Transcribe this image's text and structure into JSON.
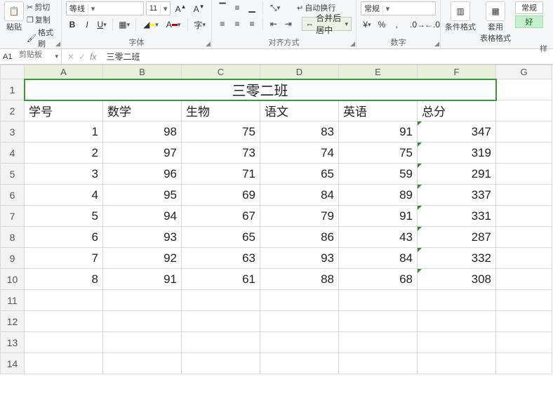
{
  "ribbon": {
    "clipboard": {
      "paste": "粘贴",
      "cut": "剪切",
      "copy": "复制",
      "format_painter": "格式刷",
      "label": "剪贴板"
    },
    "font": {
      "font_name": "等线",
      "font_size": "11",
      "bold": "B",
      "italic": "I",
      "underline": "U",
      "label": "字体"
    },
    "alignment": {
      "wrap": "自动换行",
      "merge": "合并后居中",
      "label": "对齐方式"
    },
    "number": {
      "format": "常规",
      "label": "数字"
    },
    "styles": {
      "cond_format": "条件格式",
      "table_format": "套用\n表格格式",
      "normal": "常规",
      "good": "好",
      "label": "样"
    }
  },
  "formula_bar": {
    "name_box": "A1",
    "fx": "fx",
    "value": "三零二班"
  },
  "columns": [
    "A",
    "B",
    "C",
    "D",
    "E",
    "F",
    "G"
  ],
  "row_count": 14,
  "title_row": {
    "text": "三零二班"
  },
  "header_row": [
    "学号",
    "数学",
    "生物",
    "语文",
    "英语",
    "总分"
  ],
  "data_rows": [
    [
      "1",
      "98",
      "75",
      "83",
      "91",
      "347"
    ],
    [
      "2",
      "97",
      "73",
      "74",
      "75",
      "319"
    ],
    [
      "3",
      "96",
      "71",
      "65",
      "59",
      "291"
    ],
    [
      "4",
      "95",
      "69",
      "84",
      "89",
      "337"
    ],
    [
      "5",
      "94",
      "67",
      "79",
      "91",
      "331"
    ],
    [
      "6",
      "93",
      "65",
      "86",
      "43",
      "287"
    ],
    [
      "7",
      "92",
      "63",
      "93",
      "84",
      "332"
    ],
    [
      "8",
      "91",
      "61",
      "88",
      "68",
      "308"
    ]
  ],
  "chart_data": {
    "type": "table",
    "title": "三零二班",
    "columns": [
      "学号",
      "数学",
      "生物",
      "语文",
      "英语",
      "总分"
    ],
    "rows": [
      {
        "学号": 1,
        "数学": 98,
        "生物": 75,
        "语文": 83,
        "英语": 91,
        "总分": 347
      },
      {
        "学号": 2,
        "数学": 97,
        "生物": 73,
        "语文": 74,
        "英语": 75,
        "总分": 319
      },
      {
        "学号": 3,
        "数学": 96,
        "生物": 71,
        "语文": 65,
        "英语": 59,
        "总分": 291
      },
      {
        "学号": 4,
        "数学": 95,
        "生物": 69,
        "语文": 84,
        "英语": 89,
        "总分": 337
      },
      {
        "学号": 5,
        "数学": 94,
        "生物": 67,
        "语文": 79,
        "英语": 91,
        "总分": 331
      },
      {
        "学号": 6,
        "数学": 93,
        "生物": 65,
        "语文": 86,
        "英语": 43,
        "总分": 287
      },
      {
        "学号": 7,
        "数学": 92,
        "生物": 63,
        "语文": 93,
        "英语": 84,
        "总分": 332
      },
      {
        "学号": 8,
        "数学": 91,
        "生物": 61,
        "语文": 88,
        "英语": 68,
        "总分": 308
      }
    ]
  }
}
